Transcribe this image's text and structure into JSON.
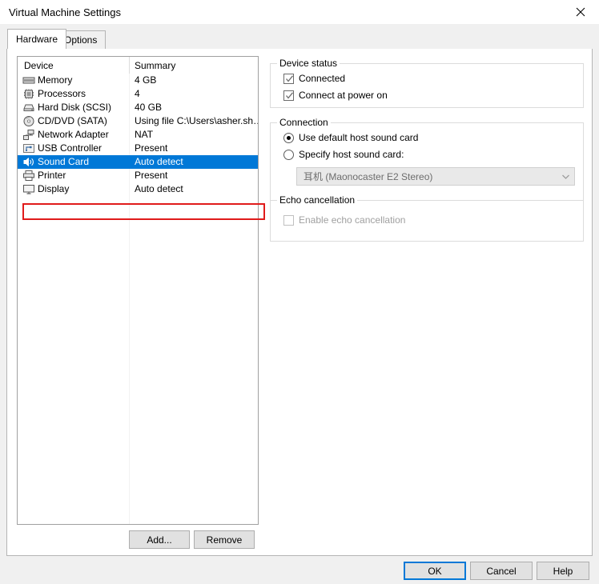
{
  "window": {
    "title": "Virtual Machine Settings",
    "close_icon": "close-icon"
  },
  "tabs": [
    {
      "label": "Hardware",
      "active": true
    },
    {
      "label": "Options",
      "active": false
    }
  ],
  "device_list": {
    "headers": {
      "device": "Device",
      "summary": "Summary"
    },
    "rows": [
      {
        "icon": "memory-icon",
        "name": "Memory",
        "summary": "4 GB",
        "selected": false
      },
      {
        "icon": "processor-icon",
        "name": "Processors",
        "summary": "4",
        "selected": false
      },
      {
        "icon": "hard-disk-icon",
        "name": "Hard Disk (SCSI)",
        "summary": "40 GB",
        "selected": false
      },
      {
        "icon": "cd-dvd-icon",
        "name": "CD/DVD (SATA)",
        "summary": "Using file C:\\Users\\asher.sh…",
        "selected": false
      },
      {
        "icon": "network-adapter-icon",
        "name": "Network Adapter",
        "summary": "NAT",
        "selected": false
      },
      {
        "icon": "usb-controller-icon",
        "name": "USB Controller",
        "summary": "Present",
        "selected": false
      },
      {
        "icon": "sound-card-icon",
        "name": "Sound Card",
        "summary": "Auto detect",
        "selected": true
      },
      {
        "icon": "printer-icon",
        "name": "Printer",
        "summary": "Present",
        "selected": false
      },
      {
        "icon": "display-icon",
        "name": "Display",
        "summary": "Auto detect",
        "selected": false
      }
    ],
    "add_label": "Add...",
    "remove_label": "Remove"
  },
  "device_status": {
    "title": "Device status",
    "connected_label": "Connected",
    "connected_checked": true,
    "power_on_label": "Connect at power on",
    "power_on_checked": true
  },
  "connection": {
    "title": "Connection",
    "use_default_label": "Use default host sound card",
    "use_default_selected": true,
    "specify_label": "Specify host sound card:",
    "specify_selected": false,
    "dropdown_value": "耳机 (Maonocaster E2 Stereo)",
    "dropdown_icon": "chevron-down-icon",
    "dropdown_disabled": true
  },
  "echo": {
    "title": "Echo cancellation",
    "enable_label": "Enable echo cancellation",
    "enable_checked": false,
    "enable_disabled": true
  },
  "footer": {
    "ok_label": "OK",
    "cancel_label": "Cancel",
    "help_label": "Help"
  },
  "colors": {
    "selection_blue": "#0078d7",
    "annotation_red": "#e01b1b",
    "dialog_gray": "#f0f0f0"
  }
}
